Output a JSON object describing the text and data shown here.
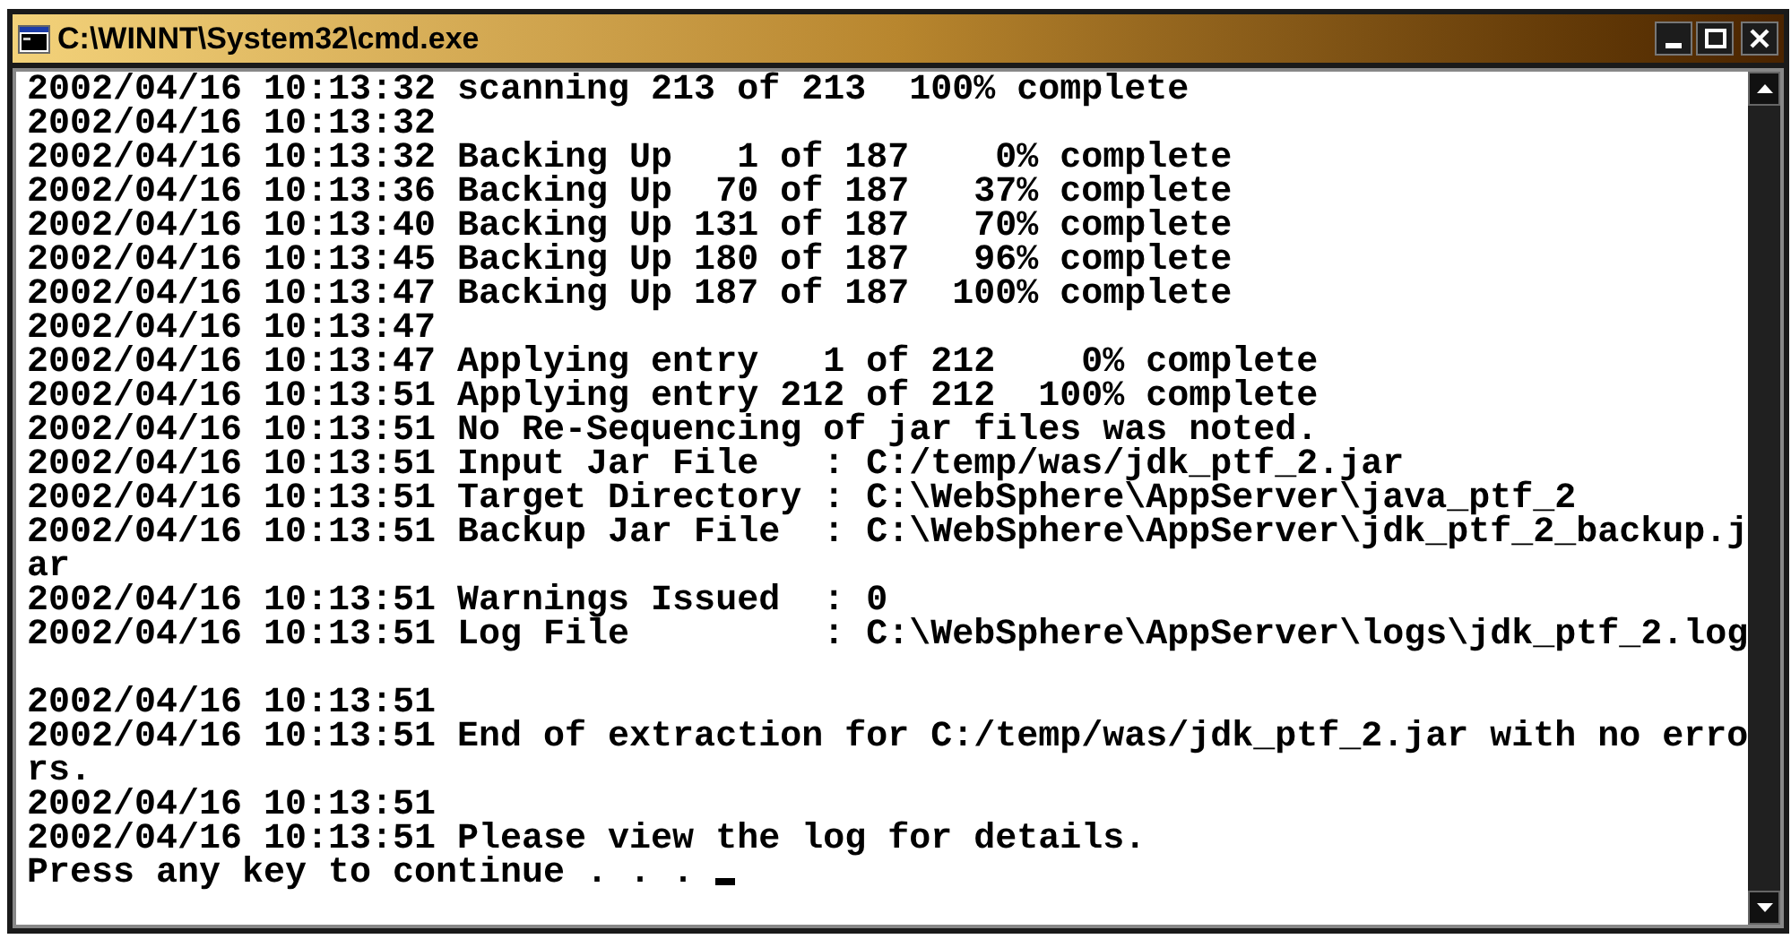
{
  "window": {
    "title": "C:\\WINNT\\System32\\cmd.exe"
  },
  "console": {
    "cursor": true,
    "lines": [
      {
        "text": "2002/04/16 10:13:32 scanning 213 of 213  100% complete"
      },
      {
        "text": "2002/04/16 10:13:32"
      },
      {
        "text": "2002/04/16 10:13:32 Backing Up   1 of 187    0% complete"
      },
      {
        "text": "2002/04/16 10:13:36 Backing Up  70 of 187   37% complete"
      },
      {
        "text": "2002/04/16 10:13:40 Backing Up 131 of 187   70% complete"
      },
      {
        "text": "2002/04/16 10:13:45 Backing Up 180 of 187   96% complete"
      },
      {
        "text": "2002/04/16 10:13:47 Backing Up 187 of 187  100% complete"
      },
      {
        "text": "2002/04/16 10:13:47"
      },
      {
        "text": "2002/04/16 10:13:47 Applying entry   1 of 212    0% complete"
      },
      {
        "text": "2002/04/16 10:13:51 Applying entry 212 of 212  100% complete"
      },
      {
        "text": "2002/04/16 10:13:51 No Re-Sequencing of jar files was noted."
      },
      {
        "text": "2002/04/16 10:13:51 Input Jar File   : C:/temp/was/jdk_ptf_2.jar"
      },
      {
        "text": "2002/04/16 10:13:51 Target Directory : C:\\WebSphere\\AppServer\\java_ptf_2"
      },
      {
        "text": "2002/04/16 10:13:51 Backup Jar File  : C:\\WebSphere\\AppServer\\jdk_ptf_2_backup.j"
      },
      {
        "text": "ar"
      },
      {
        "text": "2002/04/16 10:13:51 Warnings Issued  : 0"
      },
      {
        "text": "2002/04/16 10:13:51 Log File         : C:\\WebSphere\\AppServer\\logs\\jdk_ptf_2.log"
      },
      {
        "text": "2002/04/16 10:13:51",
        "blank_before": true
      },
      {
        "text": "2002/04/16 10:13:51 End of extraction for C:/temp/was/jdk_ptf_2.jar with no erro"
      },
      {
        "text": "rs."
      },
      {
        "text": "2002/04/16 10:13:51"
      },
      {
        "text": "2002/04/16 10:13:51 Please view the log for details."
      },
      {
        "text": "Press any key to continue . . . "
      }
    ]
  }
}
